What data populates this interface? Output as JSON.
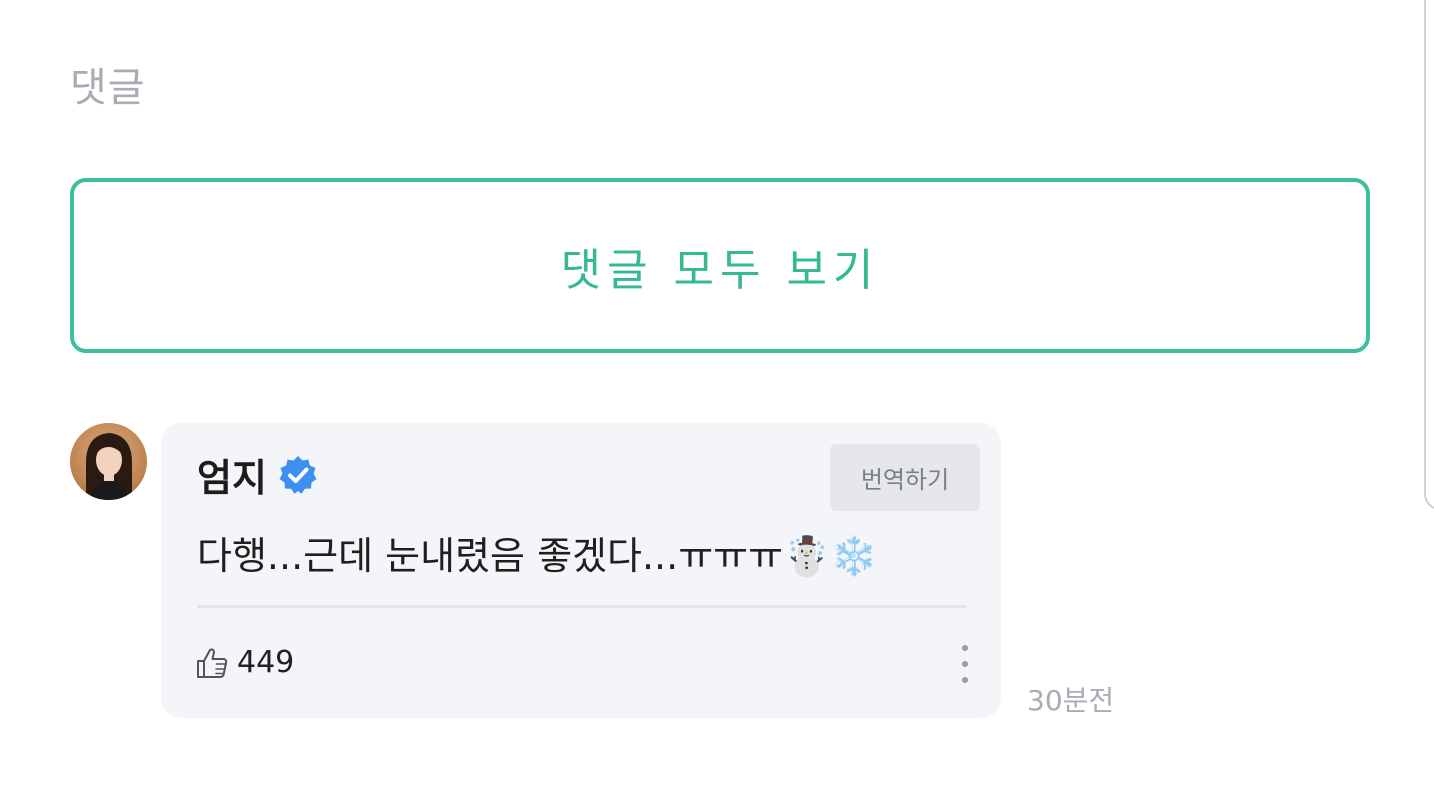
{
  "section": {
    "title": "댓글"
  },
  "view_all_button": {
    "label": "댓글 모두 보기"
  },
  "comment": {
    "author": "엄지",
    "translate_label": "번역하기",
    "text": "다행...근데 눈내렸음 좋겠다...ㅠㅠㅠ☃️❄️",
    "likes": "449",
    "timestamp": "30분전"
  },
  "icons": {
    "verified": "verified-badge-icon",
    "like": "thumbs-up-icon",
    "more": "more-vertical-icon"
  },
  "colors": {
    "accent": "#3dbf9d",
    "verified": "#3d8ff0",
    "muted_text": "#a8adb4",
    "card_bg": "#f3f5f9"
  }
}
